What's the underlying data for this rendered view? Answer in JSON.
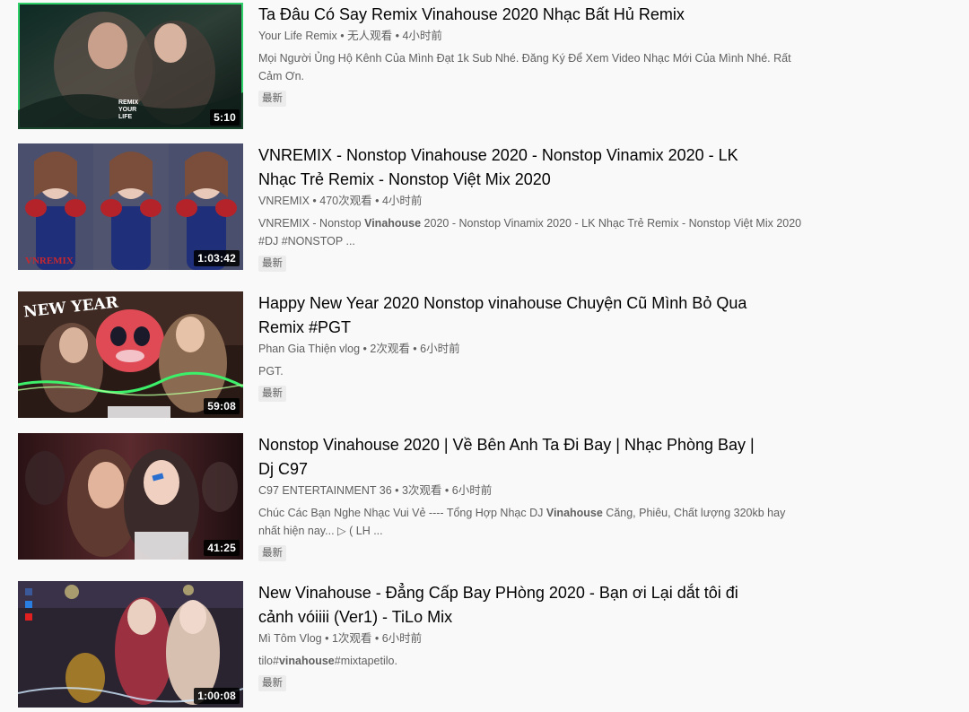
{
  "videos": [
    {
      "title": "Ta Đâu Có Say Remix Vinahouse 2020 Nhạc Bất Hủ Remix",
      "channel": "Your Life Remix",
      "views": "无人观看",
      "age": "4小时前",
      "duration": "5:10",
      "description": [
        "Mọi Người Ủng Hộ Kênh Của Mình Đạt 1k Sub Nhé. Đăng Ký Để Xem Video Nhạc Mới Của Mình Nhé. Rất Cảm Ơn."
      ],
      "badge": "最新",
      "thumb_text": "REMIX YOUR LIFE"
    },
    {
      "title": "VNREMIX - Nonstop Vinahouse 2020 - Nonstop Vinamix 2020 - LK Nhạc Trẻ Remix - Nonstop Việt Mix 2020",
      "channel": "VNREMIX",
      "views": "470次观看",
      "age": "4小时前",
      "duration": "1:03:42",
      "description": [
        "VNREMIX - Nonstop ",
        "Vinahouse",
        " 2020 - Nonstop Vinamix 2020 - LK Nhạc Trẻ Remix - Nonstop Việt Mix 2020 #DJ #NONSTOP ..."
      ],
      "badge": "最新",
      "thumb_text": "VNREMIX"
    },
    {
      "title": "Happy New Year 2020 Nonstop vinahouse Chuyện Cũ Mình Bỏ Qua Remix #PGT",
      "channel": "Phan Gia Thiện vlog",
      "views": "2次观看",
      "age": "6小时前",
      "duration": "59:08",
      "description": [
        "PGT."
      ],
      "badge": "最新",
      "thumb_text": "NEW YEAR"
    },
    {
      "title": "Nonstop Vinahouse 2020 | Về Bên Anh Ta Đi Bay | Nhạc Phòng Bay | Dj C97",
      "channel": "C97 ENTERTAINMENT 36",
      "views": "3次观看",
      "age": "6小时前",
      "duration": "41:25",
      "description": [
        "Chúc Các Bạn Nghe Nhạc Vui Vẻ ---- Tổng Hợp Nhạc DJ ",
        "Vinahouse",
        " Căng, Phiêu, Chất lượng 320kb hay nhất hiện nay... ▷ ( LH ..."
      ],
      "badge": "最新",
      "thumb_text": ""
    },
    {
      "title": "New Vinahouse - Đẳng Cấp Bay PHòng 2020 - Bạn ơi Lại dắt tôi đi cảnh vóiiii (Ver1) - TiLo Mix",
      "channel": "Mì Tôm Vlog",
      "views": "1次观看",
      "age": "6小时前",
      "duration": "1:00:08",
      "description": [
        "tilo#",
        "vinahouse",
        "#mixtapetilo."
      ],
      "badge": "最新",
      "thumb_text": ""
    }
  ],
  "separator": " • ",
  "colors": {
    "background": "#f9f9f9",
    "title": "#030303",
    "secondary": "#606060",
    "badge_bg": "#ececec"
  }
}
